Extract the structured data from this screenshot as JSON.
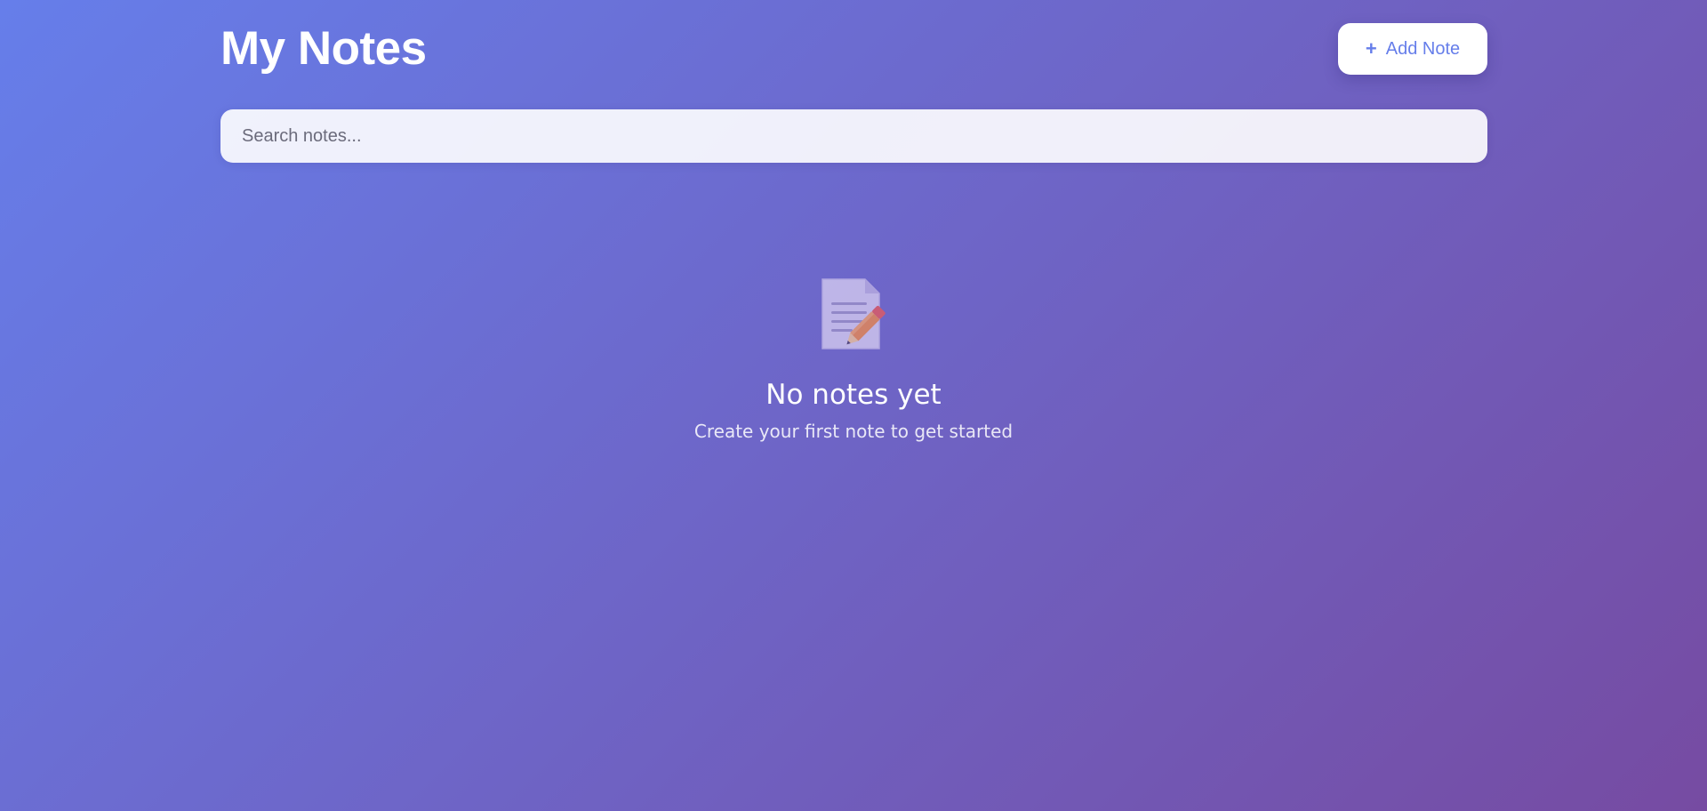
{
  "header": {
    "title": "My Notes",
    "add_button_icon": "plus-icon",
    "add_button_label": "Add Note"
  },
  "search": {
    "placeholder": "Search notes...",
    "value": ""
  },
  "empty_state": {
    "icon": "note-pencil-icon",
    "title": "No notes yet",
    "subtitle": "Create your first note to get started"
  },
  "colors": {
    "gradient_start": "#667eea",
    "gradient_end": "#764ba2",
    "accent": "#667eea"
  }
}
